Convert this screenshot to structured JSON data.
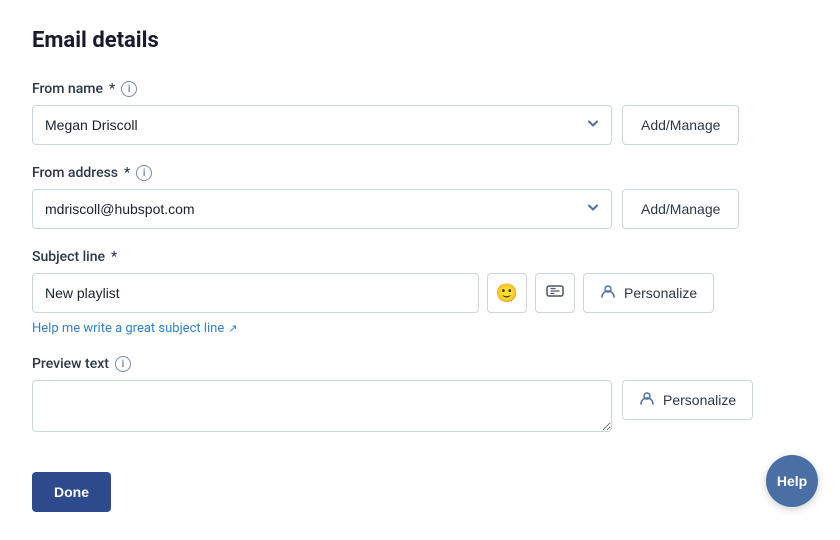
{
  "page": {
    "title": "Email details"
  },
  "from_name": {
    "label": "From name",
    "required": true,
    "value": "Megan Driscoll",
    "add_manage_label": "Add/Manage"
  },
  "from_address": {
    "label": "From address",
    "required": true,
    "value": "mdriscoll@hubspot.com",
    "add_manage_label": "Add/Manage"
  },
  "subject_line": {
    "label": "Subject line",
    "required": true,
    "value": "New playlist",
    "placeholder": "",
    "emoji_btn_label": "😊",
    "personalize_label": "Personalize",
    "help_link_text": "Help me write a great subject line"
  },
  "preview_text": {
    "label": "Preview text",
    "value": "",
    "placeholder": "",
    "personalize_label": "Personalize"
  },
  "done_btn": {
    "label": "Done"
  },
  "help_fab": {
    "label": "Help"
  }
}
